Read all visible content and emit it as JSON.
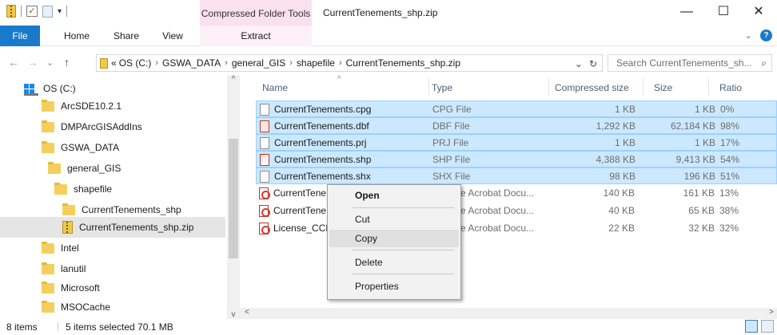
{
  "window": {
    "title": "CurrentTenements_shp.zip",
    "contextual_tab_group": "Compressed Folder Tools",
    "minimize_glyph": "—",
    "maximize_glyph": "☐",
    "close_glyph": "✕"
  },
  "ribbon": {
    "tabs": [
      "File",
      "Home",
      "Share",
      "View",
      "Extract"
    ],
    "active_color": "#1979ca"
  },
  "address": {
    "back_glyph": "←",
    "forward_glyph": "→",
    "recent_glyph": "⌄",
    "up_glyph": "↑",
    "overflow": "«",
    "crumbs": [
      "OS (C:)",
      "GSWA_DATA",
      "general_GIS",
      "shapefile",
      "CurrentTenements_shp.zip"
    ],
    "dropdown_glyph": "⌄",
    "refresh_glyph": "↻",
    "search_placeholder": "Search CurrentTenements_sh...",
    "search_glyph": "⌕"
  },
  "nav_pane": {
    "items": [
      {
        "label": "OS (C:)",
        "icon": "drive-icon"
      },
      {
        "label": "ArcSDE10.2.1",
        "icon": "folder-icon"
      },
      {
        "label": "DMPArcGISAddIns",
        "icon": "folder-icon"
      },
      {
        "label": "GSWA_DATA",
        "icon": "folder-icon"
      },
      {
        "label": "general_GIS",
        "icon": "folder-icon"
      },
      {
        "label": "shapefile",
        "icon": "folder-icon"
      },
      {
        "label": "CurrentTenements_shp",
        "icon": "folder-icon"
      },
      {
        "label": "CurrentTenements_shp.zip",
        "icon": "zip-folder-icon",
        "selected": true
      },
      {
        "label": "Intel",
        "icon": "folder-icon"
      },
      {
        "label": "lanutil",
        "icon": "folder-icon"
      },
      {
        "label": "Microsoft",
        "icon": "folder-icon"
      },
      {
        "label": "MSOCache",
        "icon": "folder-icon"
      }
    ]
  },
  "file_list": {
    "columns": [
      "Name",
      "Type",
      "Compressed size",
      "Size",
      "Ratio"
    ],
    "rows": [
      {
        "name": "CurrentTenements.cpg",
        "type": "CPG File",
        "compressed": "1 KB",
        "size": "1 KB",
        "ratio": "0%",
        "icon": "text-file-icon",
        "selected": true
      },
      {
        "name": "CurrentTenements.dbf",
        "type": "DBF File",
        "compressed": "1,292 KB",
        "size": "62,184 KB",
        "ratio": "98%",
        "icon": "dbf-file-icon",
        "selected": true
      },
      {
        "name": "CurrentTenements.prj",
        "type": "PRJ File",
        "compressed": "1 KB",
        "size": "1 KB",
        "ratio": "17%",
        "icon": "text-file-icon",
        "selected": true
      },
      {
        "name": "CurrentTenements.shp",
        "type": "SHP File",
        "compressed": "4,388 KB",
        "size": "9,413 KB",
        "ratio": "54%",
        "icon": "shp-file-icon",
        "selected": true
      },
      {
        "name": "CurrentTenements.shx",
        "type": "SHX File",
        "compressed": "98 KB",
        "size": "196 KB",
        "ratio": "51%",
        "icon": "text-file-icon",
        "selected": true
      },
      {
        "name": "CurrentTene",
        "type": "e Acrobat Docu...",
        "compressed": "140 KB",
        "size": "161 KB",
        "ratio": "13%",
        "icon": "pdf-file-icon",
        "selected": false
      },
      {
        "name": "CurrentTene",
        "type": "e Acrobat Docu...",
        "compressed": "40 KB",
        "size": "65 KB",
        "ratio": "38%",
        "icon": "pdf-file-icon",
        "selected": false
      },
      {
        "name": "License_CCB",
        "type": "e Acrobat Docu...",
        "compressed": "22 KB",
        "size": "32 KB",
        "ratio": "32%",
        "icon": "pdf-file-icon",
        "selected": false
      }
    ]
  },
  "context_menu": {
    "items": [
      "Open",
      "Cut",
      "Copy",
      "Delete",
      "Properties"
    ],
    "highlighted": "Copy"
  },
  "status_bar": {
    "item_count": "8 items",
    "selection": "5 items selected  70.1 MB"
  }
}
